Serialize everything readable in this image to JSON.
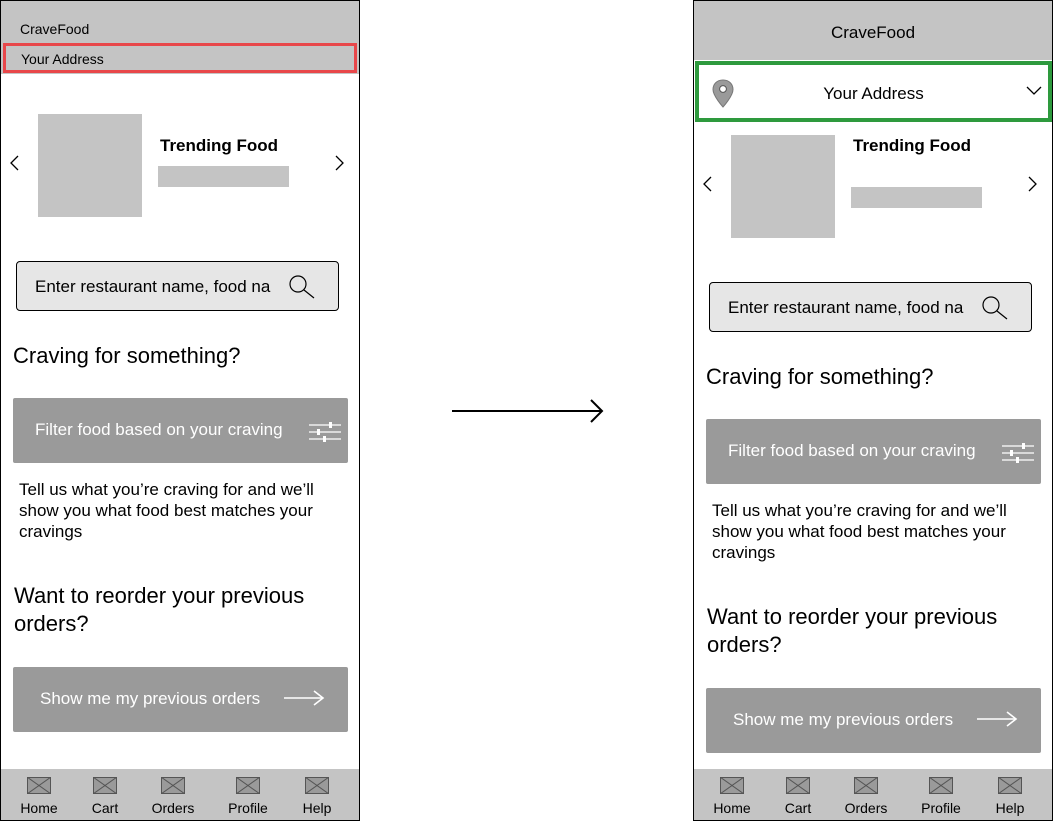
{
  "before": {
    "app_title": "CraveFood",
    "address_label": "Your Address",
    "trending_title": "Trending Food",
    "search_placeholder": "Enter restaurant name, food na",
    "craving_heading": "Craving for something?",
    "filter_button_label": "Filter food based on your craving",
    "craving_description": "Tell us what you’re craving for and we’ll show you what food best matches your cravings",
    "reorder_heading": "Want to reorder your previous orders?",
    "previous_orders_label": "Show me my previous orders",
    "nav": [
      "Home",
      "Cart",
      "Orders",
      "Profile",
      "Help"
    ]
  },
  "after": {
    "app_title": "CraveFood",
    "address_label": "Your Address",
    "trending_title": "Trending Food",
    "search_placeholder": "Enter restaurant name, food na",
    "craving_heading": "Craving for something?",
    "filter_button_label": "Filter food based on your craving",
    "craving_description": "Tell us what you’re craving for and we’ll show you what food best matches your cravings",
    "reorder_heading": "Want to reorder your previous orders?",
    "previous_orders_label": "Show me my previous orders",
    "nav": [
      "Home",
      "Cart",
      "Orders",
      "Profile",
      "Help"
    ]
  },
  "colors": {
    "highlight_before": "#e8474a",
    "highlight_after": "#2e9a3e",
    "placeholder_gray": "#c4c4c4",
    "button_gray": "#9a9a9a"
  },
  "icons": [
    "image-placeholder-icon",
    "search-icon",
    "filter-sliders-icon",
    "arrow-right-icon",
    "location-pin-icon",
    "chevron-down-icon",
    "chevron-left-icon",
    "chevron-right-icon",
    "transition-arrow-icon"
  ]
}
